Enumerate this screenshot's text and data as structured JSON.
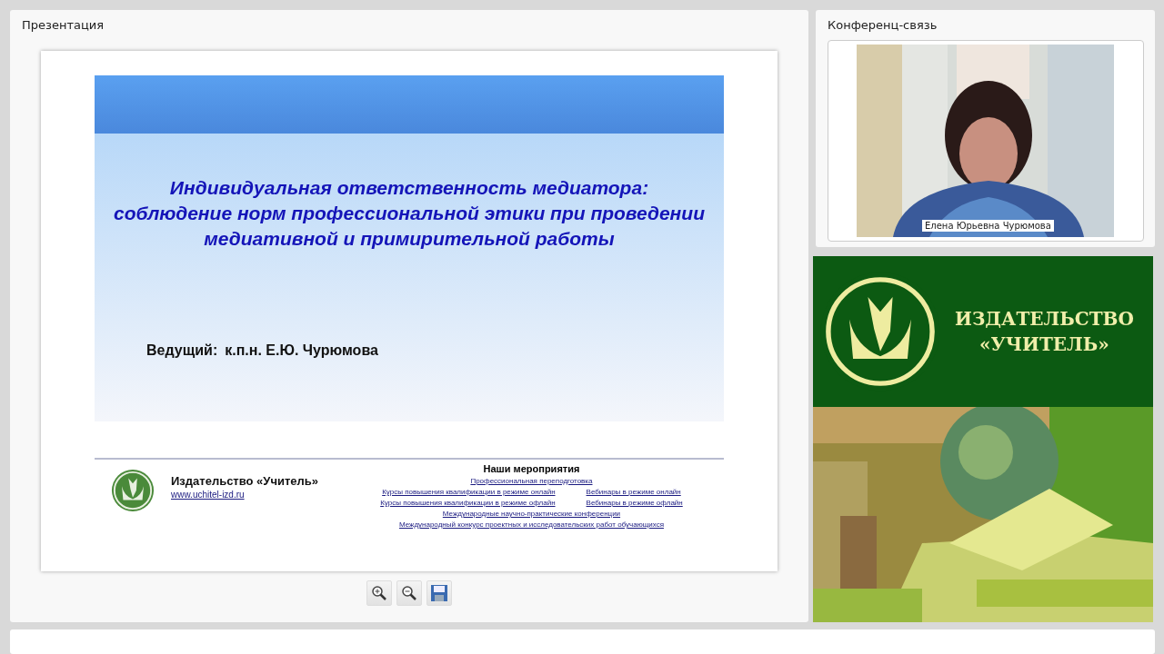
{
  "presentation": {
    "title": "Презентация",
    "slide": {
      "heading": "Индивидуальная ответственность медиатора: соблюдение норм профессиональной этики при проведении медиативной и примирительной работы",
      "presenter_label": "Ведущий:",
      "presenter": "к.п.н. Е.Ю. Чурюмова",
      "footer": {
        "publisher": "Издательство «Учитель»",
        "website": "www.uchitel-izd.ru",
        "events_title": "Наши мероприятия",
        "events": [
          {
            "label": "Профессиональная переподготовка"
          },
          {
            "label": "Курсы повышения квалификации в режиме онлайн"
          },
          {
            "label": "Вебинары в режиме онлайн"
          },
          {
            "label": "Курсы повышения квалификации в режиме офлайн"
          },
          {
            "label": "Вебинары в режиме офлайн"
          },
          {
            "label": "Международные научно-практические конференции"
          },
          {
            "label": "Международный конкурс проектных и исследовательских работ обучающихся"
          }
        ]
      }
    },
    "tools": [
      {
        "kind": "zoom-in"
      },
      {
        "kind": "zoom-out"
      },
      {
        "kind": "save"
      }
    ]
  },
  "conference": {
    "title": "Конференц-связь",
    "participant": "Елена Юрьевна Чурюмова"
  },
  "banner": {
    "line_1": "ИЗДАТЕЛЬСТВО",
    "line_2": "«УЧИТЕЛЬ»"
  }
}
